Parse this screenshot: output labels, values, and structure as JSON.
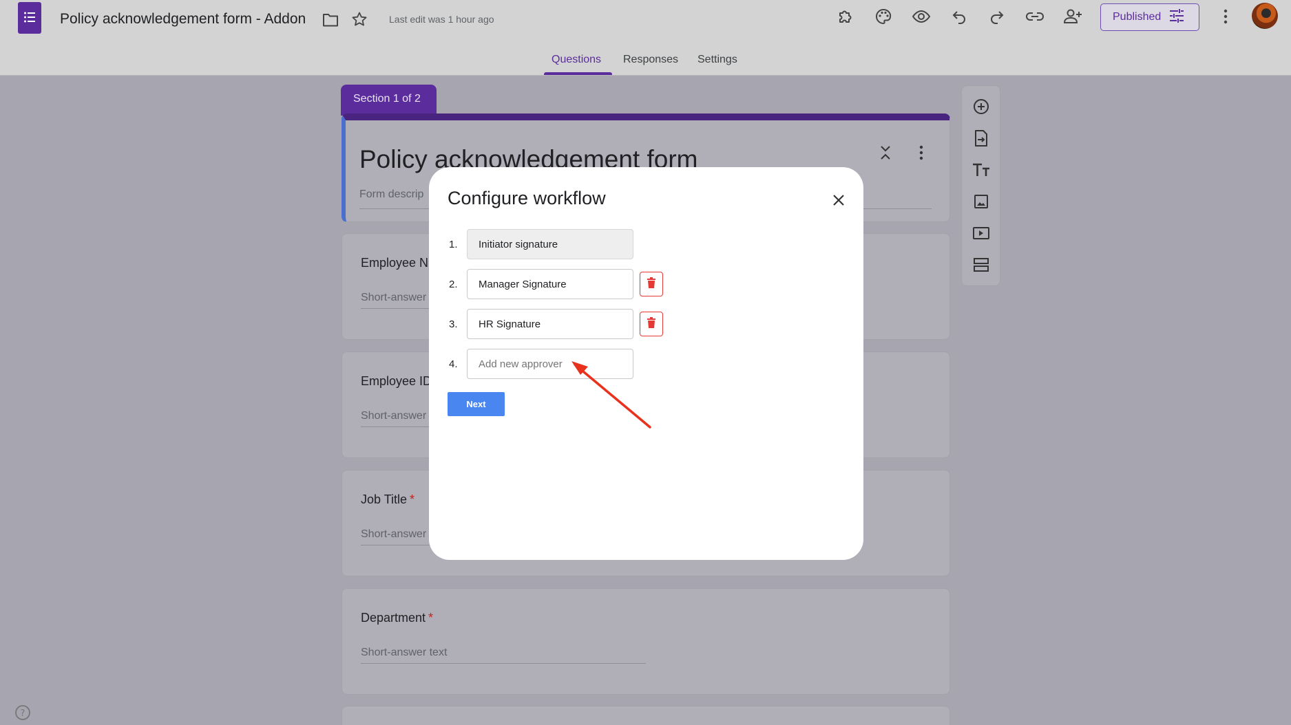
{
  "header": {
    "doc_title": "Policy acknowledgement form - Addon",
    "last_edit": "Last edit was 1 hour ago",
    "publish_label": "Published",
    "icons": [
      "folder-icon",
      "star-icon",
      "addon-icon",
      "palette-icon",
      "preview-icon",
      "undo-icon",
      "redo-icon",
      "link-icon",
      "add-collaborator-icon",
      "publish-settings-icon",
      "more-vert-icon"
    ]
  },
  "tabs": [
    {
      "label": "Questions",
      "active": true
    },
    {
      "label": "Responses",
      "active": false
    },
    {
      "label": "Settings",
      "active": false
    }
  ],
  "form": {
    "section_label": "Section 1 of 2",
    "title": "Policy acknowledgement form",
    "description_placeholder": "Form descrip",
    "questions": [
      {
        "label": "Employee N",
        "required": false,
        "placeholder": "Short-answer"
      },
      {
        "label": "Employee ID",
        "required": false,
        "placeholder": "Short-answer"
      },
      {
        "label": "Job Title",
        "required": true,
        "placeholder": "Short-answer"
      },
      {
        "label": "Department",
        "required": true,
        "placeholder": "Short-answer text"
      }
    ],
    "required_mark": "*"
  },
  "side_toolbar": [
    "add-question-icon",
    "import-questions-icon",
    "add-title-icon",
    "add-image-icon",
    "add-video-icon",
    "add-section-icon"
  ],
  "modal": {
    "title": "Configure workflow",
    "steps": [
      {
        "num": "1.",
        "value": "Initiator signature",
        "deletable": false
      },
      {
        "num": "2.",
        "value": "Manager Signature",
        "deletable": true
      },
      {
        "num": "3.",
        "value": "HR Signature",
        "deletable": true
      },
      {
        "num": "4.",
        "value": "",
        "placeholder": "Add new approver",
        "deletable": false
      }
    ],
    "next_label": "Next"
  },
  "colors": {
    "brand_purple": "#5b2d9c",
    "next_blue": "#4a86f0",
    "delete_red": "#e53935",
    "annotation_arrow": "#e8321e"
  }
}
